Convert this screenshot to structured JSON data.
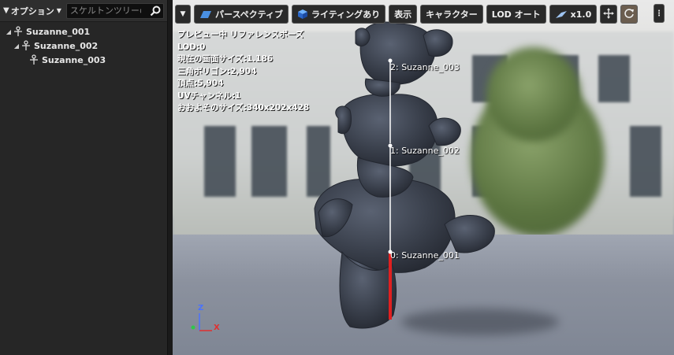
{
  "tree_panel": {
    "options_label": "オプション",
    "search_placeholder": "スケルトンツリーの検索",
    "bones": [
      {
        "name": "Suzanne_001"
      },
      {
        "name": "Suzanne_002"
      },
      {
        "name": "Suzanne_003"
      }
    ]
  },
  "toolbar": {
    "perspective_label": "パースペクティブ",
    "lighting_label": "ライティングあり",
    "show_label": "表示",
    "character_label": "キャラクター",
    "lod_label": "LOD オート",
    "speed_label": "x1.0"
  },
  "overlay": {
    "lines": [
      "プレビュー中 リファレンスポーズ",
      "LOD:0",
      "現在の画面サイズ:1.186",
      "三角ポリゴン:2,904",
      "頂点:5,904",
      "UVチャンネル:1",
      "おおよそのサイズ:340x202x428"
    ]
  },
  "bone_labels": [
    "2: Suzanne_003",
    "1: Suzanne_002",
    "0: Suzanne_001"
  ],
  "axes": {
    "z": "Z",
    "x": "X"
  },
  "colors": {
    "panel": "#262626",
    "button": "#2a2a2a",
    "bone_root": "#e02020",
    "accent_blue": "#4a90e2"
  }
}
